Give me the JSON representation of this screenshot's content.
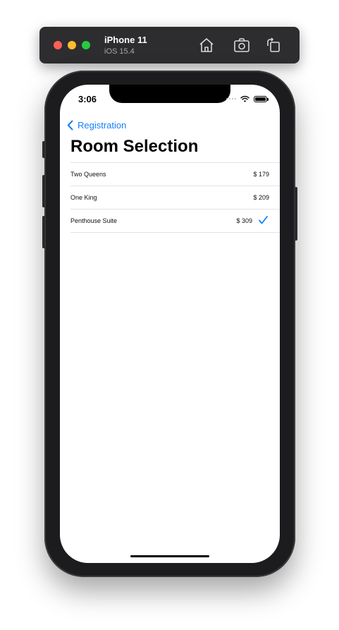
{
  "simulator": {
    "device_name": "iPhone 11",
    "os_version": "iOS 15.4",
    "buttons": [
      "home-icon",
      "screenshot-icon",
      "rotate-icon"
    ]
  },
  "status_bar": {
    "time": "3:06"
  },
  "navigation": {
    "back_label": "Registration",
    "title": "Room Selection",
    "accent_color": "#147efb"
  },
  "rooms": [
    {
      "name": "Two Queens",
      "price": "$ 179",
      "selected": false
    },
    {
      "name": "One King",
      "price": "$ 209",
      "selected": false
    },
    {
      "name": "Penthouse Suite",
      "price": "$ 309",
      "selected": true
    }
  ]
}
